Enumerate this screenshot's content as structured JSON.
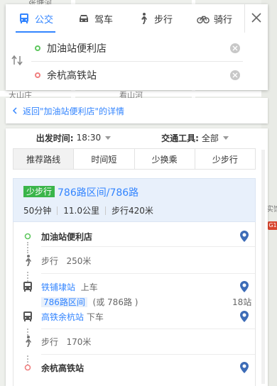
{
  "map": {
    "labels": [
      "张塘河",
      "大山庄",
      "看山河",
      "实馆"
    ],
    "shield": "G1"
  },
  "search": {
    "tabs": [
      {
        "label": "公交",
        "icon": "bus-icon",
        "active": true
      },
      {
        "label": "驾车",
        "icon": "car-icon",
        "active": false
      },
      {
        "label": "步行",
        "icon": "walk-icon",
        "active": false
      },
      {
        "label": "骑行",
        "icon": "bike-icon",
        "active": false
      }
    ],
    "origin": "加油站便利店",
    "destination": "余杭高铁站"
  },
  "back_link": "返回\"加油站便利店\"的详情",
  "filters": {
    "depart_label": "出发时间:",
    "depart_value": "18:30",
    "transport_label": "交通工具:",
    "transport_value": "全部"
  },
  "sort_tabs": [
    "推荐路线",
    "时间短",
    "少换乘",
    "少步行"
  ],
  "route": {
    "tag": "少步行",
    "name": "786路区间/786路",
    "duration": "50分钟",
    "distance": "11.0公里",
    "walk": "步行420米"
  },
  "steps": {
    "start": "加油站便利店",
    "walk1_label": "步行",
    "walk1_dist": "250米",
    "board_station": "铁铺埭站",
    "board_action": "上车",
    "line_name": "786路区间",
    "line_alt": "(或 786路 )",
    "stop_count": "18站",
    "alight_station": "高铁余杭站",
    "alight_action": "下车",
    "walk2_label": "步行",
    "walk2_dist": "170米",
    "end": "余杭高铁站"
  },
  "colors": {
    "accent": "#3385ff",
    "tag_green": "#3ab54a",
    "origin_dot": "#5fc75f",
    "dest_dot": "#f08080"
  }
}
